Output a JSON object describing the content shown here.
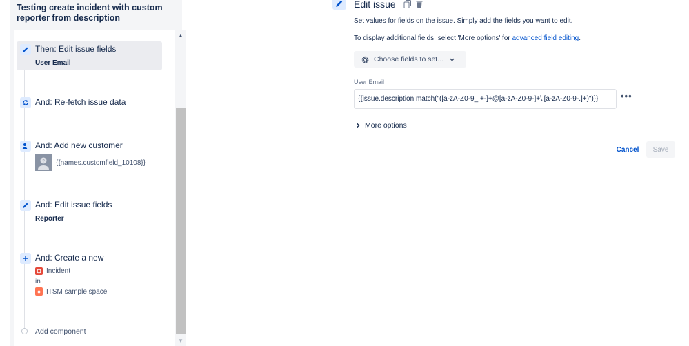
{
  "rule": {
    "title": "Testing create incident with custom reporter from description"
  },
  "components": [
    {
      "title": "Then: Edit issue fields",
      "subtitle": "User Email",
      "icon": "pencil-icon",
      "selected": true
    },
    {
      "title": "And: Re-fetch issue data",
      "icon": "refresh-icon"
    },
    {
      "title": "And: Add new customer",
      "value": "{{names.customfield_10108}}",
      "icon": "add-user-icon"
    },
    {
      "title": "And: Edit issue fields",
      "subtitle": "Reporter",
      "icon": "pencil-icon"
    },
    {
      "title": "And: Create a new",
      "issue_type": "Incident",
      "in_label": "in",
      "space": "ITSM sample space",
      "icon": "plus-icon"
    }
  ],
  "add_component": "Add component",
  "edit_panel": {
    "title": "Edit issue",
    "description": "Set values for fields on the issue. Simply add the fields you want to edit.",
    "additional_prefix": "To display additional fields, select 'More options' for ",
    "additional_link": "advanced field editing",
    "additional_suffix": ".",
    "choose_fields": "Choose fields to set...",
    "field_label": "User Email",
    "field_value": "{{issue.description.match(\"([a-zA-Z0-9_.+-]+@[a-zA-Z0-9-]+\\.[a-zA-Z0-9-.]+)\")}}",
    "more_options": "More options",
    "cancel": "Cancel",
    "save": "Save"
  },
  "colors": {
    "accent": "#0052cc",
    "icon_bg": "#deebff",
    "incident": "#e5493a",
    "space": "#ff7452"
  }
}
